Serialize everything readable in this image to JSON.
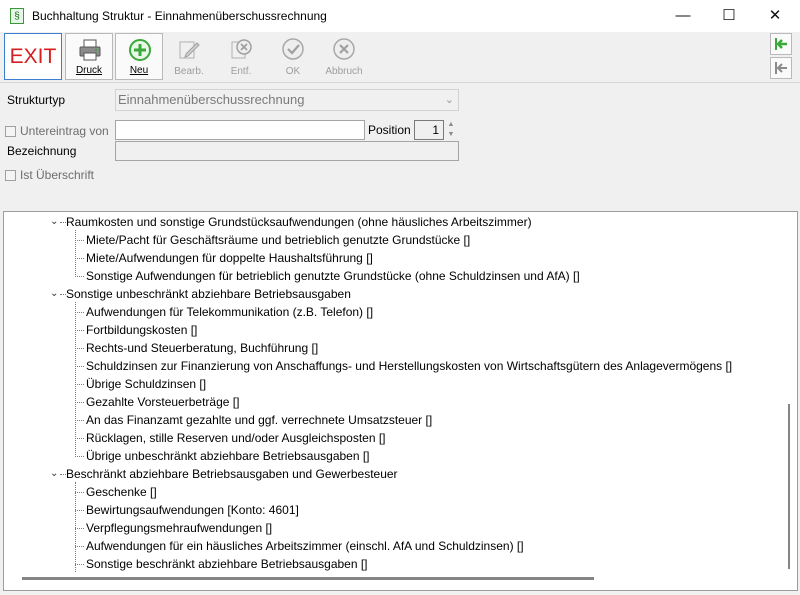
{
  "window": {
    "title": "Buchhaltung Struktur - Einnahmenüberschussrechnung",
    "app_icon": "§",
    "min": "—",
    "max": "☐",
    "close": "✕"
  },
  "toolbar": {
    "exit_label": "EXIT",
    "druck_label": "Druck",
    "neu_label": "Neu",
    "bearb_label": "Bearb.",
    "entf_label": "Entf.",
    "ok_label": "OK",
    "abbruch_label": "Abbruch",
    "accent_green": "#3aa83a",
    "exit_color": "#d42020"
  },
  "form": {
    "strukturtyp_label": "Strukturtyp",
    "strukturtyp_value": "Einnahmenüberschussrechnung",
    "untereintrag_label": "Untereintrag von",
    "position_label": "Position",
    "position_value": "1",
    "bezeichnung_label": "Bezeichnung",
    "ist_ueberschrift_label": "Ist Überschrift"
  },
  "tree": {
    "groups": [
      {
        "label": "Raumkosten und sonstige Grundstücksaufwendungen (ohne häusliches Arbeitszimmer)",
        "children": [
          "Miete/Pacht für Geschäftsräume und betrieblich genutzte Grundstücke    []",
          "Miete/Aufwendungen für doppelte Haushaltsführung    []",
          "Sonstige Aufwendungen für betrieblich genutzte Grundstücke (ohne Schuldzinsen und AfA)    []"
        ]
      },
      {
        "label": "Sonstige unbeschränkt abziehbare Betriebsausgaben",
        "children": [
          "Aufwendungen für Telekommunikation (z.B. Telefon)    []",
          "Fortbildungskosten    []",
          "Rechts-und Steuerberatung, Buchführung    []",
          "Schuldzinsen zur Finanzierung von Anschaffungs- und Herstellungskosten von Wirtschaftsgütern des Anlagevermögens    []",
          "Übrige Schuldzinsen    []",
          "Gezahlte Vorsteuerbeträge    []",
          "An das Finanzamt gezahlte und ggf. verrechnete Umsatzsteuer    []",
          "Rücklagen, stille Reserven und/oder Ausgleichsposten    []",
          "Übrige unbeschränkt abziehbare Betriebsausgaben    []"
        ]
      },
      {
        "label": "Beschränkt abziehbare Betriebsausgaben und Gewerbesteuer",
        "children": [
          "Geschenke    []",
          "Bewirtungsaufwendungen    [Konto: 4601]",
          "Verpflegungsmehraufwendungen    []",
          "Aufwendungen für ein häusliches Arbeitszimmer (einschl. AfA und Schuldzinsen)    []",
          "Sonstige beschränkt abziehbare Betriebsausgaben    []"
        ]
      }
    ]
  }
}
